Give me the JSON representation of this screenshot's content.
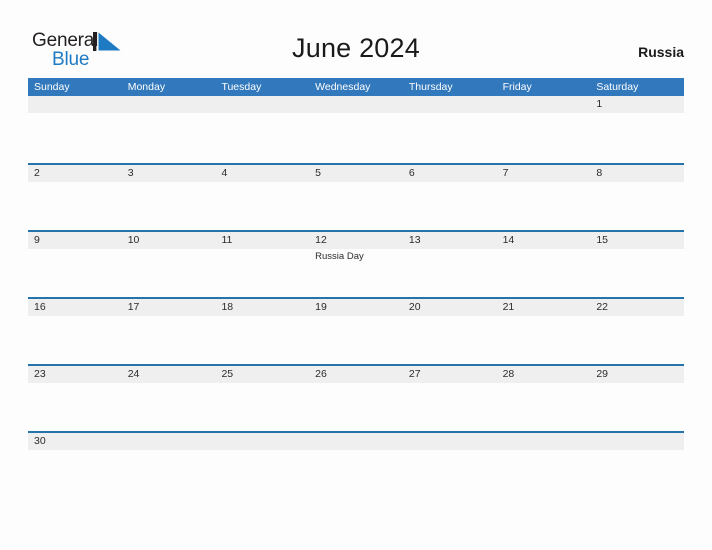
{
  "branding": {
    "logo_line1": "General",
    "logo_line2": "Blue",
    "logo_flag_icon": "flag-triangle-icon",
    "accent_color": "#1f7ac4"
  },
  "header": {
    "title": "June 2024",
    "country": "Russia"
  },
  "colors": {
    "header_blue": "#3278bc",
    "row_divider_blue": "#2573ab",
    "day_band_gray": "#efefef",
    "page_background": "#fdfdfd",
    "text_dark": "#2b2b2b"
  },
  "calendar": {
    "month": "June",
    "year": "2024",
    "weekday_headers": [
      "Sunday",
      "Monday",
      "Tuesday",
      "Wednesday",
      "Thursday",
      "Friday",
      "Saturday"
    ],
    "weeks": [
      {
        "days": [
          {
            "num": "",
            "events": []
          },
          {
            "num": "",
            "events": []
          },
          {
            "num": "",
            "events": []
          },
          {
            "num": "",
            "events": []
          },
          {
            "num": "",
            "events": []
          },
          {
            "num": "",
            "events": []
          },
          {
            "num": "1",
            "events": []
          }
        ]
      },
      {
        "days": [
          {
            "num": "2",
            "events": []
          },
          {
            "num": "3",
            "events": []
          },
          {
            "num": "4",
            "events": []
          },
          {
            "num": "5",
            "events": []
          },
          {
            "num": "6",
            "events": []
          },
          {
            "num": "7",
            "events": []
          },
          {
            "num": "8",
            "events": []
          }
        ]
      },
      {
        "days": [
          {
            "num": "9",
            "events": []
          },
          {
            "num": "10",
            "events": []
          },
          {
            "num": "11",
            "events": []
          },
          {
            "num": "12",
            "events": [
              "Russia Day"
            ]
          },
          {
            "num": "13",
            "events": []
          },
          {
            "num": "14",
            "events": []
          },
          {
            "num": "15",
            "events": []
          }
        ]
      },
      {
        "days": [
          {
            "num": "16",
            "events": []
          },
          {
            "num": "17",
            "events": []
          },
          {
            "num": "18",
            "events": []
          },
          {
            "num": "19",
            "events": []
          },
          {
            "num": "20",
            "events": []
          },
          {
            "num": "21",
            "events": []
          },
          {
            "num": "22",
            "events": []
          }
        ]
      },
      {
        "days": [
          {
            "num": "23",
            "events": []
          },
          {
            "num": "24",
            "events": []
          },
          {
            "num": "25",
            "events": []
          },
          {
            "num": "26",
            "events": []
          },
          {
            "num": "27",
            "events": []
          },
          {
            "num": "28",
            "events": []
          },
          {
            "num": "29",
            "events": []
          }
        ]
      },
      {
        "days": [
          {
            "num": "30",
            "events": []
          },
          {
            "num": "",
            "events": []
          },
          {
            "num": "",
            "events": []
          },
          {
            "num": "",
            "events": []
          },
          {
            "num": "",
            "events": []
          },
          {
            "num": "",
            "events": []
          },
          {
            "num": "",
            "events": []
          }
        ]
      }
    ]
  }
}
